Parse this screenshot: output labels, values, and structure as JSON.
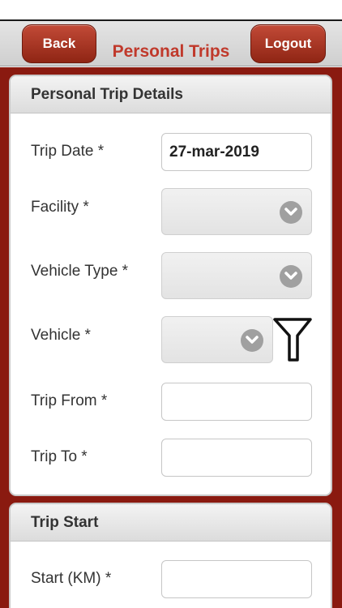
{
  "header": {
    "back_label": "Back",
    "title": "Personal Trips",
    "logout_label": "Logout"
  },
  "details_section": {
    "title": "Personal Trip Details",
    "trip_date_label": "Trip Date *",
    "trip_date_value": "27-mar-2019",
    "facility_label": "Facility *",
    "vehicle_type_label": "Vehicle Type *",
    "vehicle_label": "Vehicle *",
    "trip_from_label": "Trip From *",
    "trip_to_label": "Trip To *"
  },
  "start_section": {
    "title": "Trip Start",
    "start_km_label": "Start (KM) *"
  },
  "icons": {
    "dropdown": "chevron-down-icon",
    "filter": "filter-icon"
  },
  "colors": {
    "brand_red": "#8a1a10",
    "title_red": "#c0392b",
    "button_red": "#a83220"
  }
}
